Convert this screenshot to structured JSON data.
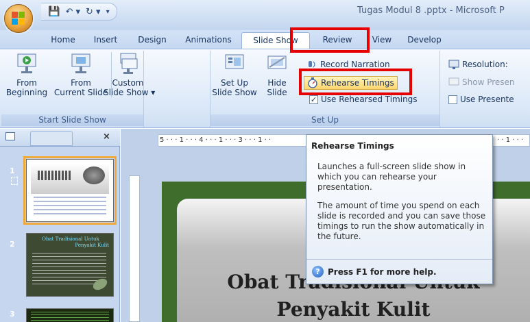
{
  "window": {
    "title": "Tugas Modul 8 .pptx - Microsoft P"
  },
  "tabs": [
    "Home",
    "Insert",
    "Design",
    "Animations",
    "Slide Show",
    "Review",
    "View",
    "Develop"
  ],
  "active_tab": "Slide Show",
  "ribbon": {
    "start_group": {
      "label": "Start Slide Show",
      "from_beginning": [
        "From",
        "Beginning"
      ],
      "from_current": [
        "From",
        "Current Slide"
      ],
      "custom": [
        "Custom",
        "Slide Show ▾"
      ]
    },
    "setup_group": {
      "label": "Set Up",
      "setup_show": [
        "Set Up",
        "Slide Show"
      ],
      "hide_slide": [
        "Hide",
        "Slide"
      ],
      "record_narration": "Record Narration",
      "rehearse_timings": "Rehearse Timings",
      "use_rehearsed": "Use Rehearsed Timings"
    },
    "monitors_group": {
      "resolution": "Resolution:",
      "show_presentation_on": "Show Presen",
      "use_presenter": "Use Presente"
    }
  },
  "ruler": {
    "marks": "5 · · · 1 · · · 4 · · · 1 · · · 3 · · · 1 · ·",
    "right_marks": "· · 1 · · ·"
  },
  "slides_panel": {
    "numbers": [
      "1",
      "2",
      "3"
    ],
    "thumb2_title": [
      "Obat Tradisional Untuk",
      "Penyakit Kulit"
    ]
  },
  "slide": {
    "title_line1": "Obat Tradisional Untuk",
    "title_line2": "Penyakit Kulit"
  },
  "tooltip": {
    "title": "Rehearse Timings",
    "para1": "Launches a full-screen slide show in which you can rehearse your presentation.",
    "para2": "The amount of time you spend on each slide is recorded and you can save those timings to run the show automatically in the future.",
    "help": "Press F1 for more help."
  },
  "colors": {
    "highlight_border": "#e60000",
    "slide_frame": "#3f6d2c"
  }
}
